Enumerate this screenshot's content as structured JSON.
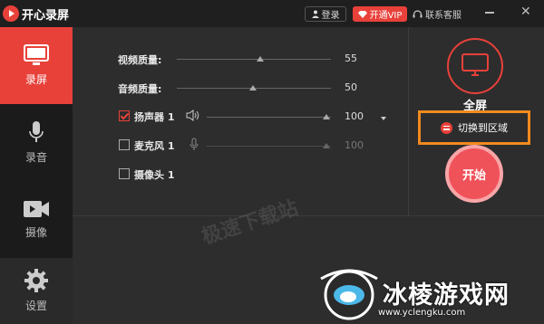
{
  "titlebar": {
    "app_title": "开心录屏",
    "login_label": "登录",
    "vip_label": "开通VIP",
    "service_label": "联系客服",
    "minimize_icon": "minimize-icon",
    "close_icon": "close-icon"
  },
  "sidebar": {
    "items": [
      {
        "label": "录屏",
        "icon": "monitor-icon",
        "active": true
      },
      {
        "label": "录音",
        "icon": "microphone-icon",
        "active": false
      },
      {
        "label": "摄像",
        "icon": "video-camera-icon",
        "active": false
      },
      {
        "label": "设置",
        "icon": "gear-icon",
        "active": false
      }
    ]
  },
  "settings": {
    "video_quality": {
      "label": "视频质量:",
      "value": "55"
    },
    "audio_quality": {
      "label": "音频质量:",
      "value": "50"
    },
    "speaker": {
      "label": "扬声器 1",
      "value": "100",
      "checked": true
    },
    "microphone": {
      "label": "麦克风 1",
      "value": "100",
      "checked": false
    },
    "camera": {
      "label": "摄像头 1",
      "checked": false
    }
  },
  "right_panel": {
    "fullscreen_label": "全屏",
    "switch_label": "切换到区域",
    "start_label": "开始"
  },
  "watermark": "极速下载站",
  "overlay": {
    "brand_name": "冰棱游戏网",
    "brand_url": "www.yclengku.com"
  },
  "colors": {
    "accent": "#e8413a",
    "highlight_border": "#f28a1e",
    "background": "#2d2d2d"
  }
}
